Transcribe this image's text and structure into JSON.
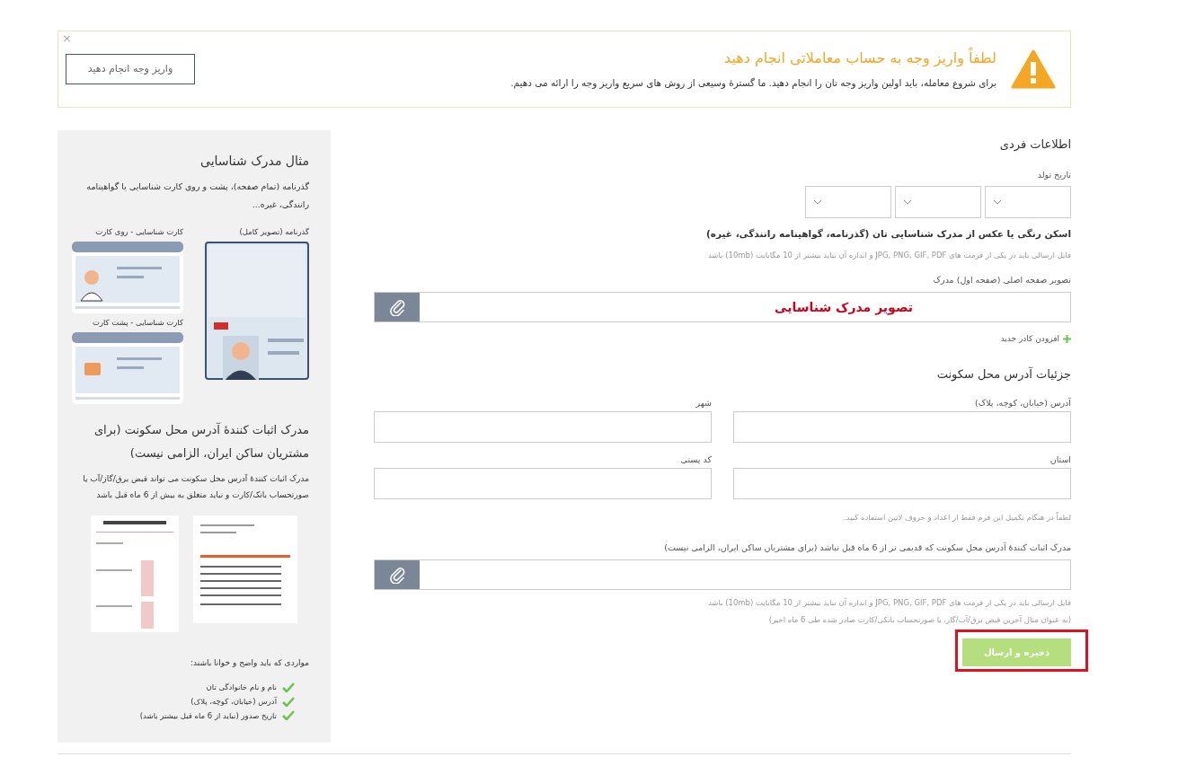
{
  "banner": {
    "close": "×",
    "title": "لطفاً واریز وجه به حساب معاملاتی انجام دهید",
    "message": "برای شروع معامله، باید اولین واریز وجه تان را انجام دهید. ما گسترۀ وسیعی از روش های سریع واریز وجه را ارائه می دهیم.",
    "button": "واریز وجه انجام دهید"
  },
  "personal": {
    "heading": "اطلاعات فردی",
    "birth_date_label": "تاریخ تولد"
  },
  "id_upload": {
    "label": "اسکن رنگی یا عکس از مدرک شناسایی تان (گذرنامه، گواهینامه رانندگی، غیره)",
    "hint": "فایل ارسالی باید در یکی از فرمت های JPG, PNG, GIF, PDF و اندازه آن نباید بیشتر از 10 مگابایت (10mb) باشد",
    "field_label": "تصویر صفحه اصلی (صفحه اول) مدرک",
    "file_text": "تصویر مدرک شناسایی",
    "add_more": "افزودن کادر جدید"
  },
  "address": {
    "heading": "جزئیات آدرس محل سکونت",
    "fields": [
      {
        "label": "آدرس (خیابان، کوچه، پلاک)"
      },
      {
        "label": "شهر"
      },
      {
        "label": "استان"
      },
      {
        "label": "کد پستی"
      }
    ],
    "note": "لطفاً در هنگام تکمیل این فرم فقط از اعداد و حروف لاتین استفاده کنید."
  },
  "proof": {
    "label": "مدرک اثبات کنندۀ آدرس محل سکونت که قدیمی تر از 6 ماه قبل نباشد (برای مشتریان ساکن ایران، الزامی نیست)",
    "hint": "فایل ارسالی باید در یکی از فرمت های JPG, PNG, GIF, PDF و اندازه آن نباید بیشتر از 10 مگابایت (10mb) باشد",
    "example": "(به عنوان مثال آخرین قبض برق/آب/گاز، یا صورتحساب بانکی/کارت صادر شده طی 6 ماه اخیر)"
  },
  "submit": {
    "label": "ذخیره و ارسال",
    "highlighted": true
  },
  "sidebar": {
    "id_title": "مثال مدرک شناسایی",
    "id_desc": "گذرنامه (تمام صفحه)، پشت و روی کارت شناسایی یا گواهینامه رانندگی، غیره...",
    "id_samples": [
      {
        "caption": "گذرنامه (تصویر کامل)",
        "kind": "passport"
      },
      {
        "caption": "کارت شناسایی - روی کارت",
        "kind": "card-front"
      },
      {
        "caption": "کارت شناسایی - پشت کارت",
        "kind": "card-back"
      }
    ],
    "address_title": "مدرک اثبات کنندۀ آدرس محل سکونت (برای مشتریان ساکن ایران، الزامی نیست)",
    "address_desc": "مدرک اثبات کنندۀ آدرس محل سکونت می تواند قبض برق/گاز/آب یا صورتحساب بانک/کارت و نباید متعلق به بیش از 6 ماه قبل باشد",
    "checklist_title": "مواردی که باید واضح و خوانا باشند:",
    "checklist": [
      {
        "text": "نام و نام خانوادگی تان"
      },
      {
        "text": "آدرس (خیابان، کوچه، پلاک)"
      },
      {
        "text": "تاریخ صدور (نباید از 6 ماه قبل بیشتر باشد)"
      }
    ]
  }
}
